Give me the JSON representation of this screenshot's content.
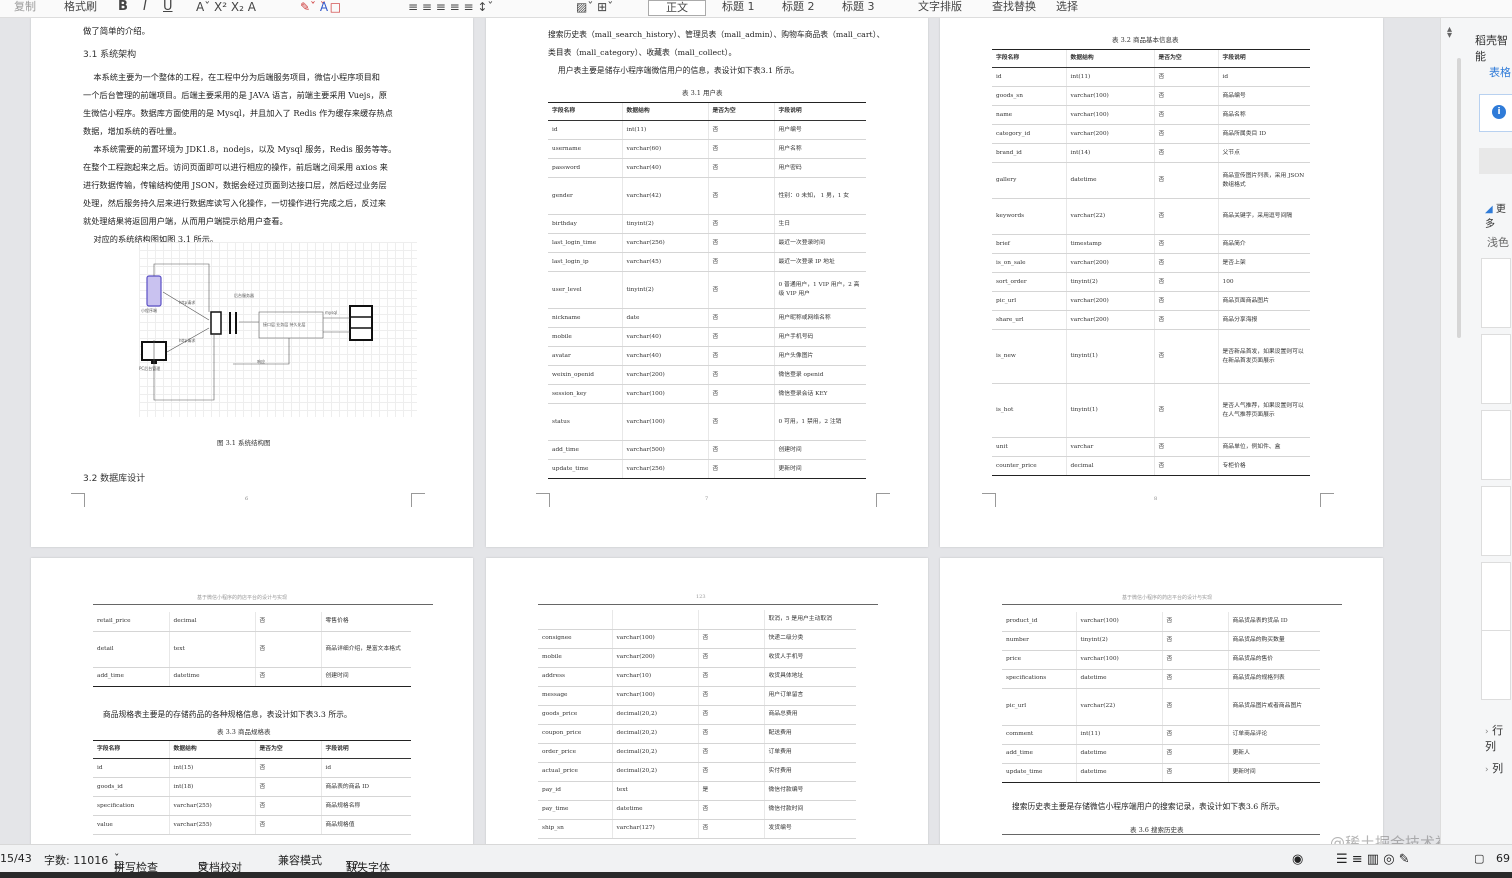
{
  "toolbar": {
    "copy": "复制",
    "format_painter": "格式刷",
    "bold": "B",
    "italic": "I",
    "underline": "U",
    "styles": [
      "正文",
      "标题 1",
      "标题 2",
      "标题 3"
    ],
    "text_layout": "文字排版",
    "find_replace": "查找替换",
    "select": "选择"
  },
  "page1": {
    "top_text": "做了简单的介绍。",
    "heading_31": "3.1 系统架构",
    "para1": "    本系统主要为一个整体的工程，在工程中分为后端服务项目，微信小程序项目和\n一个后台管理的前端项目。后端主要采用的是 JAVA 语言，前端主要采用 Vuejs，原\n生微信小程序。数据库方面使用的是 Mysql，并且加入了 Redis 作为缓存来缓存热点\n数据，增加系统的吞吐量。\n    本系统需要的前置环境为 JDK1.8，nodejs，以及 Mysql 服务，Redis 服务等等。\n在整个工程跑起来之后。访问页面即可以进行相应的操作，前后端之间采用 axios 来\n进行数据传输，传输结构使用 JSON，数据会经过页面到达接口层，然后经过业务层\n处理，然后服务持久层来进行数据库读写入化操作，一切操作进行完成之后，反过来\n就处理结果将返回用户端，从而用户端提示给用户查看。\n    对应的系统结构图如图 3.1 所示。",
    "figure_caption": "图 3.1   系统结构图",
    "heading_32": "3.2 数据库设计",
    "diagram_labels": {
      "phone": "小程序端",
      "pc": "PC后台管理",
      "center": "后台服务器",
      "interface": "接口层 业务层 持久化层",
      "http1": "http请求",
      "http2": "http请求",
      "resp": "响应",
      "db": "mysql"
    }
  },
  "page2": {
    "top_text": "搜索历史表（mall_search_history）、管理员表（mall_admin）、购物车商品表（mall_cart）、\n类目表（mall_category）、收藏表（mall_collect）。\n    用户表主要是储存小程序端微信用户的信息，表设计如下表3.1 所示。",
    "caption": "表 3.1   用户表",
    "headers": [
      "字段名称",
      "数据结构",
      "是否为空",
      "字段说明"
    ],
    "rows": [
      [
        "id",
        "int(11)",
        "否",
        "用户编号"
      ],
      [
        "username",
        "varchar(60)",
        "否",
        "用户名称"
      ],
      [
        "password",
        "varchar(40)",
        "否",
        "用户密码"
      ],
      [
        "gender",
        "varchar(42)",
        "否",
        "性别：0 未知， 1 男，1 女"
      ],
      [
        "birthday",
        "tinyint(2)",
        "否",
        "生日"
      ],
      [
        "last_login_time",
        "varchar(256)",
        "否",
        "最近一次登录时间"
      ],
      [
        "last_login_ip",
        "varchar(45)",
        "否",
        "最近一次登录 IP 地址"
      ],
      [
        "user_level",
        "tinyint(2)",
        "否",
        "0 普通用户，1 VIP 用户，2 高级 VIP 用户"
      ],
      [
        "nickname",
        "date",
        "否",
        "用户昵称或网络名称"
      ],
      [
        "mobile",
        "varchar(40)",
        "否",
        "用户手机号码"
      ],
      [
        "avatar",
        "varchar(40)",
        "否",
        "用户头像图片"
      ],
      [
        "weixin_openid",
        "varchar(200)",
        "否",
        "微信登录 openid"
      ],
      [
        "session_key",
        "varchar(100)",
        "否",
        "微信登录会话 KEY"
      ],
      [
        "status",
        "varchar(100)",
        "否",
        "0 可用，1 禁用，2 注销"
      ],
      [
        "add_time",
        "varchar(500)",
        "否",
        "创建时间"
      ],
      [
        "update_time",
        "varchar(256)",
        "否",
        "更新时间"
      ]
    ]
  },
  "page3": {
    "caption": "表 3.2   商品基本信息表",
    "headers": [
      "字段名称",
      "数据结构",
      "是否为空",
      "字段说明"
    ],
    "rows": [
      [
        "id",
        "int(11)",
        "否",
        "id"
      ],
      [
        "goods_sn",
        "varchar(100)",
        "否",
        "商品编号"
      ],
      [
        "name",
        "varchar(100)",
        "否",
        "商品名称"
      ],
      [
        "category_id",
        "varchar(200)",
        "否",
        "商品所属类目 ID"
      ],
      [
        "brand_id",
        "int(14)",
        "否",
        "父节点"
      ],
      [
        "gallery",
        "datetime",
        "否",
        "商品宣传图片列表，采用 JSON 数组格式"
      ],
      [
        "keywords",
        "varchar(22)",
        "否",
        "商品关键字，采用逗号间隔"
      ],
      [
        "brief",
        "timestamp",
        "否",
        "商品简介"
      ],
      [
        "is_on_sale",
        "varchar(200)",
        "否",
        "是否上架"
      ],
      [
        "sort_order",
        "tinyint(2)",
        "否",
        "100"
      ],
      [
        "pic_url",
        "varchar(200)",
        "否",
        "商品页面商品图片"
      ],
      [
        "share_url",
        "varchar(200)",
        "否",
        "商品分享海报"
      ],
      [
        "is_new",
        "tinyint(1)",
        "否",
        "是否新品首发，如果设置则可以在新品首发页面展示"
      ],
      [
        "is_hot",
        "tinyint(1)",
        "否",
        "是否人气推荐，如果设置则可以在人气推荐页面展示"
      ],
      [
        "unit",
        "varchar",
        "否",
        "商品单位，例如件、盒"
      ],
      [
        "counter_price",
        "decimal",
        "否",
        "专柜价格"
      ]
    ]
  },
  "page4": {
    "header_text": "基于微信小程序的药店平台的设计与实现",
    "rows_top": [
      [
        "retail_price",
        "decimal",
        "否",
        "零售价格"
      ],
      [
        "detail",
        "text",
        "否",
        "商品详细介绍，是富文本格式"
      ],
      [
        "add_time",
        "datetime",
        "否",
        "创建时间"
      ]
    ],
    "para": "    商品规格表主要是的存储药品的各种规格信息，表设计如下表3.3 所示。",
    "caption": "表 3.3   商品规格表",
    "headers": [
      "字段名称",
      "数据结构",
      "是否为空",
      "字段说明"
    ],
    "rows": [
      [
        "id",
        "int(15)",
        "否",
        "id"
      ],
      [
        "goods_id",
        "int(18)",
        "否",
        "商品表的商品 ID"
      ],
      [
        "specification",
        "varchar(255)",
        "否",
        "商品规格名称"
      ],
      [
        "value",
        "varchar(255)",
        "否",
        "商品规格值"
      ]
    ]
  },
  "page5": {
    "header_text": "123",
    "rows": [
      [
        "",
        "",
        "",
        "取消，5 是用户主动取消"
      ],
      [
        "consignee",
        "varchar(100)",
        "否",
        "快递二级分类"
      ],
      [
        "mobile",
        "varchar(200)",
        "否",
        "收货人手机号"
      ],
      [
        "address",
        "varchar(10)",
        "否",
        "收货具体地址"
      ],
      [
        "message",
        "varchar(100)",
        "否",
        "用户订单留言"
      ],
      [
        "goods_price",
        "decimal(20,2)",
        "否",
        "商品总费用"
      ],
      [
        "coupon_price",
        "decimal(20,2)",
        "否",
        "配送费用"
      ],
      [
        "order_price",
        "decimal(20,2)",
        "否",
        "订单费用"
      ],
      [
        "actual_price",
        "decimal(20,2)",
        "否",
        "实付费用"
      ],
      [
        "pay_id",
        "text",
        "是",
        "微信付款编号"
      ],
      [
        "pay_time",
        "datetime",
        "否",
        "微信付款时间"
      ],
      [
        "ship_sn",
        "varchar(127)",
        "否",
        "发货编号"
      ]
    ]
  },
  "page6": {
    "header_text": "基于微信小程序的药店平台的设计与实现",
    "rows": [
      [
        "product_id",
        "varchar(100)",
        "否",
        "商品货品表的货品 ID"
      ],
      [
        "number",
        "tinyint(2)",
        "否",
        "商品货品的购买数量"
      ],
      [
        "price",
        "varchar(100)",
        "否",
        "商品货品的售价"
      ],
      [
        "specifications",
        "datetime",
        "否",
        "商品货品的规格列表"
      ],
      [
        "pic_url",
        "varchar(22)",
        "否",
        "商品货品图片或者商品图片"
      ],
      [
        "comment",
        "int(11)",
        "否",
        "订单商品评论"
      ],
      [
        "add_time",
        "datetime",
        "否",
        "更新人"
      ],
      [
        "update_time",
        "datetime",
        "否",
        "更新时间"
      ]
    ],
    "para": "    搜索历史表主要是存储微信小程序端用户的搜索记录，表设计如下表3.6 所示。",
    "caption": "表 3.6   搜索历史表"
  },
  "right_panel": {
    "title": "稻壳智能",
    "tab": "表格",
    "more": "更多",
    "light": "浅色",
    "row": "行列",
    "col": "列"
  },
  "status_bar": {
    "page": "15/43",
    "word_count": "字数: 11016",
    "spell_check": "拼写检查",
    "doc_check": "文档校对",
    "compat": "兼容模式",
    "missing_font": "缺失字体",
    "zoom": "69"
  },
  "watermark": "@稀土掘金技术社区",
  "colors": {
    "accent": "#2f7bd8",
    "background": "#e4e5e8",
    "panel": "#f5f6f7"
  }
}
